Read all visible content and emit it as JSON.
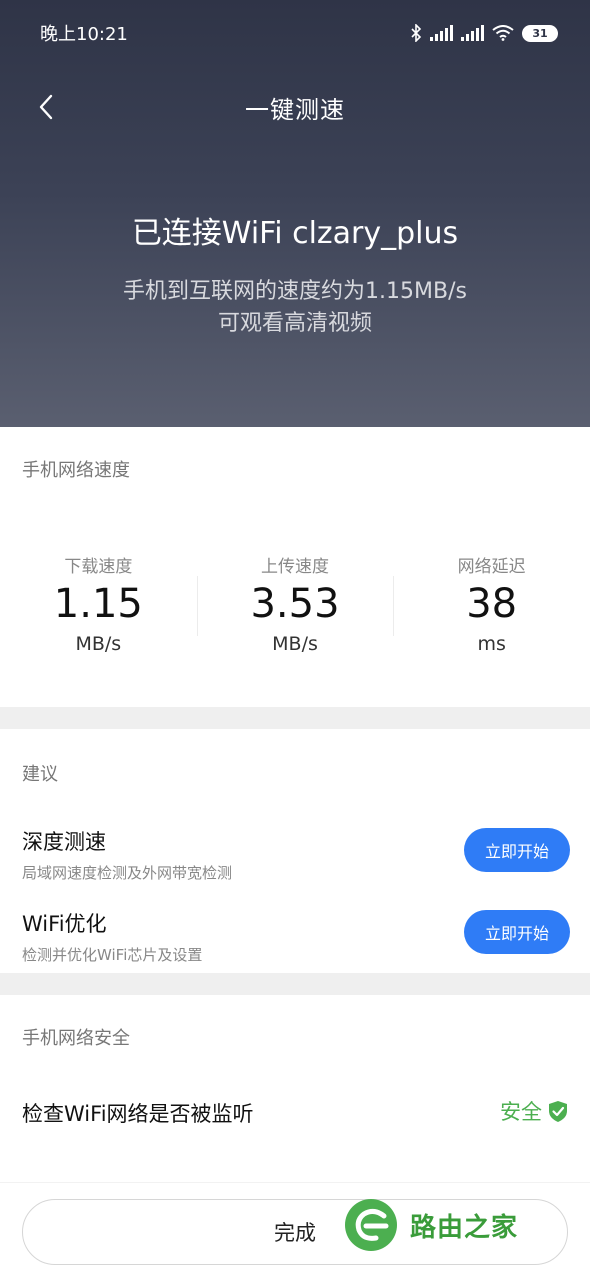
{
  "status_bar": {
    "time": "晚上10:21",
    "battery": "31",
    "icons": [
      "bluetooth-icon",
      "signal-icon",
      "signal-icon",
      "wifi-icon",
      "battery-icon"
    ]
  },
  "nav": {
    "back_icon": "chevron-left-icon",
    "title": "一键测速"
  },
  "hero": {
    "title": "已连接WiFi clzary_plus",
    "subtitle_line1": "手机到互联网的速度约为1.15MB/s",
    "subtitle_line2": "可观看高清视频"
  },
  "speed": {
    "section_label": "手机网络速度",
    "metrics": [
      {
        "label": "下载速度",
        "value": "1.15",
        "unit": "MB/s"
      },
      {
        "label": "上传速度",
        "value": "3.53",
        "unit": "MB/s"
      },
      {
        "label": "网络延迟",
        "value": "38",
        "unit": "ms"
      }
    ]
  },
  "suggestions": {
    "section_label": "建议",
    "items": [
      {
        "title": "深度测速",
        "desc": "局域网速度检测及外网带宽检测",
        "button": "立即开始"
      },
      {
        "title": "WiFi优化",
        "desc": "检测并优化WiFi芯片及设置",
        "button": "立即开始"
      }
    ]
  },
  "security": {
    "section_label": "手机网络安全",
    "items": [
      {
        "text": "检查WiFi网络是否被监听",
        "status": "安全",
        "status_icon": "shield-check-icon"
      }
    ]
  },
  "footer": {
    "done_label": "完成"
  },
  "watermark": {
    "text": "路由之家"
  },
  "colors": {
    "accent_blue": "#2f7cf6",
    "safe_green": "#4caf50",
    "hero_top": "#2f3447",
    "hero_bottom": "#5a5f70"
  }
}
